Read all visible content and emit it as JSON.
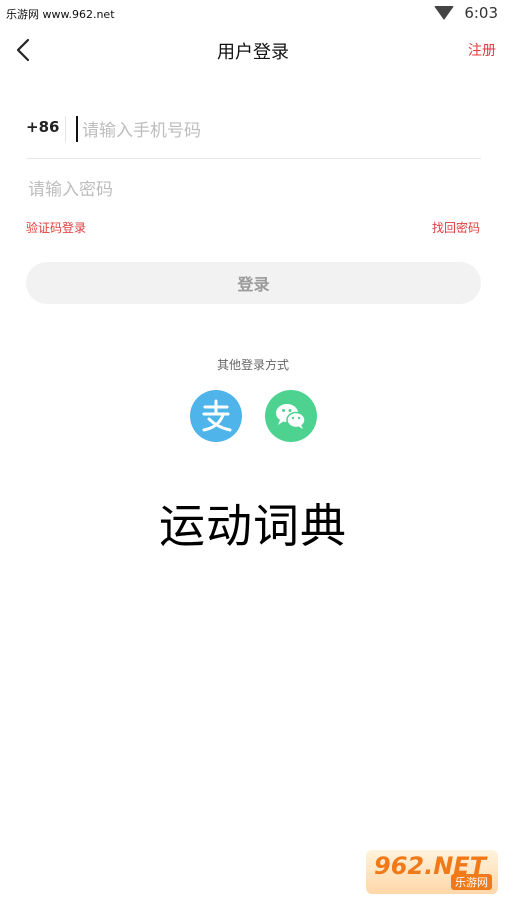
{
  "status_bar": {
    "left_text": "乐游网 www.962.net",
    "time": "6:03"
  },
  "header": {
    "title": "用户登录",
    "register_label": "注册"
  },
  "form": {
    "country_code": "+86",
    "phone_placeholder": "请输入手机号码",
    "password_placeholder": "请输入密码",
    "sms_login_label": "验证码登录",
    "forgot_password_label": "找回密码",
    "login_button_label": "登录"
  },
  "other_login": {
    "label": "其他登录方式"
  },
  "overlay_caption": "运动词典",
  "watermark": {
    "main": "962.NET",
    "sub": "乐游网"
  },
  "colors": {
    "accent": "#e23b3b",
    "alipay": "#4fb4ea",
    "wechat": "#4dd290"
  }
}
